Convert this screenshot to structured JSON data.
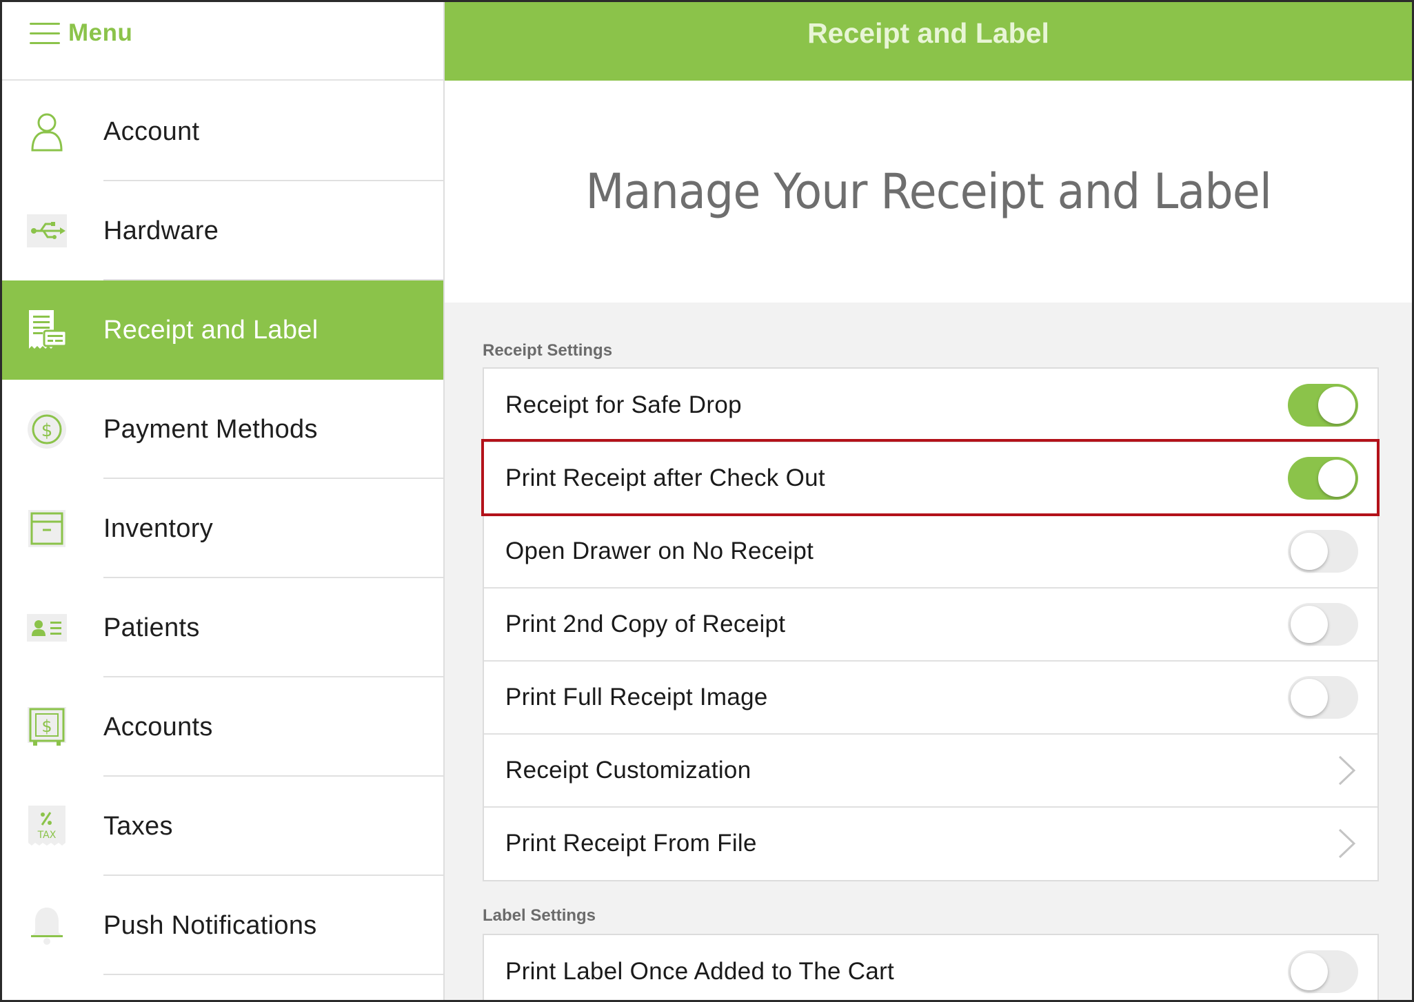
{
  "app": {
    "accent_color": "#8bc34a",
    "menu_label": "Menu"
  },
  "sidebar": {
    "items": [
      {
        "label": "Account",
        "icon": "person-icon",
        "active": false
      },
      {
        "label": "Hardware",
        "icon": "usb-icon",
        "active": false
      },
      {
        "label": "Receipt and Label",
        "icon": "receipt-icon",
        "active": true
      },
      {
        "label": "Payment Methods",
        "icon": "dollar-coin-icon",
        "active": false
      },
      {
        "label": "Inventory",
        "icon": "archive-box-icon",
        "active": false
      },
      {
        "label": "Patients",
        "icon": "id-card-icon",
        "active": false
      },
      {
        "label": "Accounts",
        "icon": "safe-icon",
        "active": false
      },
      {
        "label": "Taxes",
        "icon": "tax-icon",
        "active": false
      },
      {
        "label": "Push Notifications",
        "icon": "bell-icon",
        "active": false
      }
    ]
  },
  "header": {
    "title": "Receipt and Label"
  },
  "hero": {
    "title": "Manage Your Receipt and Label"
  },
  "receipt_settings": {
    "header": "Receipt Settings",
    "rows": [
      {
        "label": "Receipt for Safe Drop",
        "control": "toggle",
        "on": true
      },
      {
        "label": "Print Receipt after Check Out",
        "control": "toggle",
        "on": true,
        "highlighted": true
      },
      {
        "label": "Open Drawer on No Receipt",
        "control": "toggle",
        "on": false
      },
      {
        "label": "Print 2nd Copy of Receipt",
        "control": "toggle",
        "on": false
      },
      {
        "label": "Print Full Receipt Image",
        "control": "toggle",
        "on": false
      },
      {
        "label": "Receipt Customization",
        "control": "chevron"
      },
      {
        "label": "Print Receipt From File",
        "control": "chevron"
      }
    ]
  },
  "label_settings": {
    "header": "Label Settings",
    "rows": [
      {
        "label": "Print Label Once Added to The Cart",
        "control": "toggle",
        "on": false
      }
    ]
  }
}
